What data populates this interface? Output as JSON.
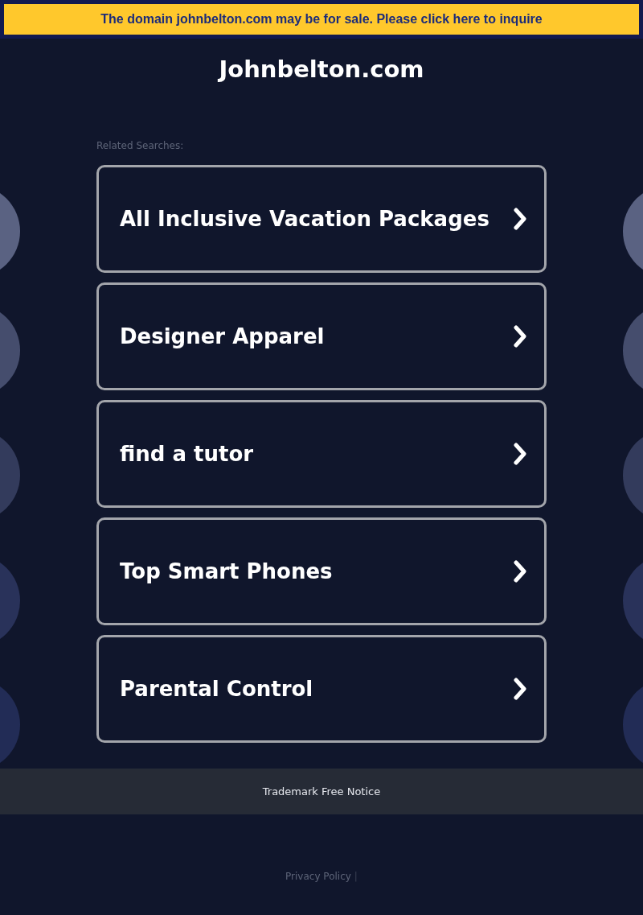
{
  "banner": {
    "text": "The domain johnbelton.com may be for sale. Please click here to inquire"
  },
  "site_title": "Johnbelton.com",
  "related_searches": {
    "heading": "Related Searches:",
    "items": [
      {
        "label": "All Inclusive Vacation Packages"
      },
      {
        "label": "Designer Apparel"
      },
      {
        "label": "find a tutor"
      },
      {
        "label": "Top Smart Phones"
      },
      {
        "label": "Parental Control"
      }
    ]
  },
  "trademark_notice": "Trademark Free Notice",
  "footer": {
    "links": [
      "Privacy Policy"
    ],
    "separator": "|"
  }
}
